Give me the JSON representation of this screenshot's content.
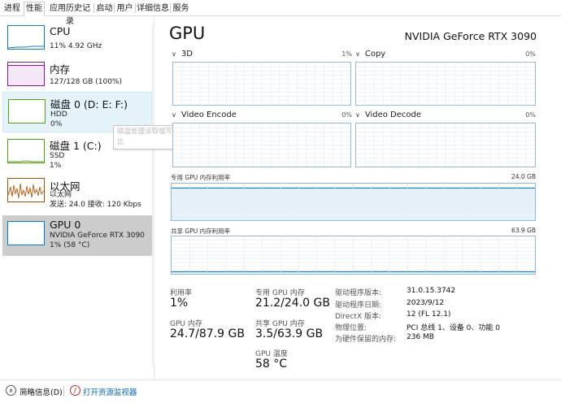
{
  "tabs": [
    "进程",
    "性能",
    "应用历史记录",
    "启动",
    "用户",
    "详细信息",
    "服务"
  ],
  "active_tab": "性能",
  "sidebar": {
    "items": [
      {
        "title": "CPU",
        "sub1": "11% 4.92 GHz",
        "sub2": "",
        "sub3": "",
        "color": "#117dbb"
      },
      {
        "title": "内存",
        "sub1": "127/128 GB (100%)",
        "sub2": "",
        "sub3": "",
        "color": "#8b12ae"
      },
      {
        "title": "磁盘 0 (D: E: F:)",
        "sub1": "HDD",
        "sub2": "0%",
        "sub3": "",
        "color": "#4da60c"
      },
      {
        "title": "磁盘 1 (C:)",
        "sub1": "SSD",
        "sub2": "1%",
        "sub3": "",
        "color": "#4da60c"
      },
      {
        "title": "以太网",
        "sub1": "以太网",
        "sub2": "发送: 24.0 接收: 120 Kbps",
        "sub3": "",
        "color": "#a74f01"
      },
      {
        "title": "GPU 0",
        "sub1": "NVIDIA GeForce RTX 3090",
        "sub2": "1% (58 °C)",
        "sub3": "",
        "color": "#0078d7"
      }
    ]
  },
  "tooltip": "磁盘处理读取或写入请求的时间百分比",
  "main": {
    "title": "GPU",
    "device": "NVIDIA GeForce RTX 3090",
    "engines": [
      {
        "name": "3D",
        "pct": "1%"
      },
      {
        "name": "Copy",
        "pct": "0%"
      },
      {
        "name": "Video Encode",
        "pct": "0%"
      },
      {
        "name": "Video Decode",
        "pct": "0%"
      }
    ],
    "dedicated_label": "专用 GPU 内存利用率",
    "dedicated_max": "24.0 GB",
    "dedicated_fill": 0.88,
    "shared_label": "共享 GPU 内存利用率",
    "shared_max": "63.9 GB",
    "shared_fill": 0.055
  },
  "stats": {
    "util_label": "利用率",
    "util_value": "1%",
    "gpumem_label": "GPU 内存",
    "gpumem_value": "24.7/87.9 GB",
    "dedicated_label": "专用 GPU 内存",
    "dedicated_value": "21.2/24.0 GB",
    "shared_label": "共享 GPU 内存",
    "shared_value": "3.5/63.9 GB",
    "temp_label": "GPU 温度",
    "temp_value": "58 °C"
  },
  "info": [
    {
      "key": "驱动程序版本:",
      "val": "31.0.15.3742"
    },
    {
      "key": "驱动程序日期:",
      "val": "2023/9/12"
    },
    {
      "key": "DirectX 版本:",
      "val": "12 (FL 12.1)"
    },
    {
      "key": "物理位置:",
      "val": "PCI 总线 1、设备 0、功能 0"
    },
    {
      "key": "为硬件保留的内存:",
      "val": "236 MB"
    }
  ],
  "footer": {
    "summary": "简略信息(D)",
    "open_monitor": "打开资源监视器"
  }
}
